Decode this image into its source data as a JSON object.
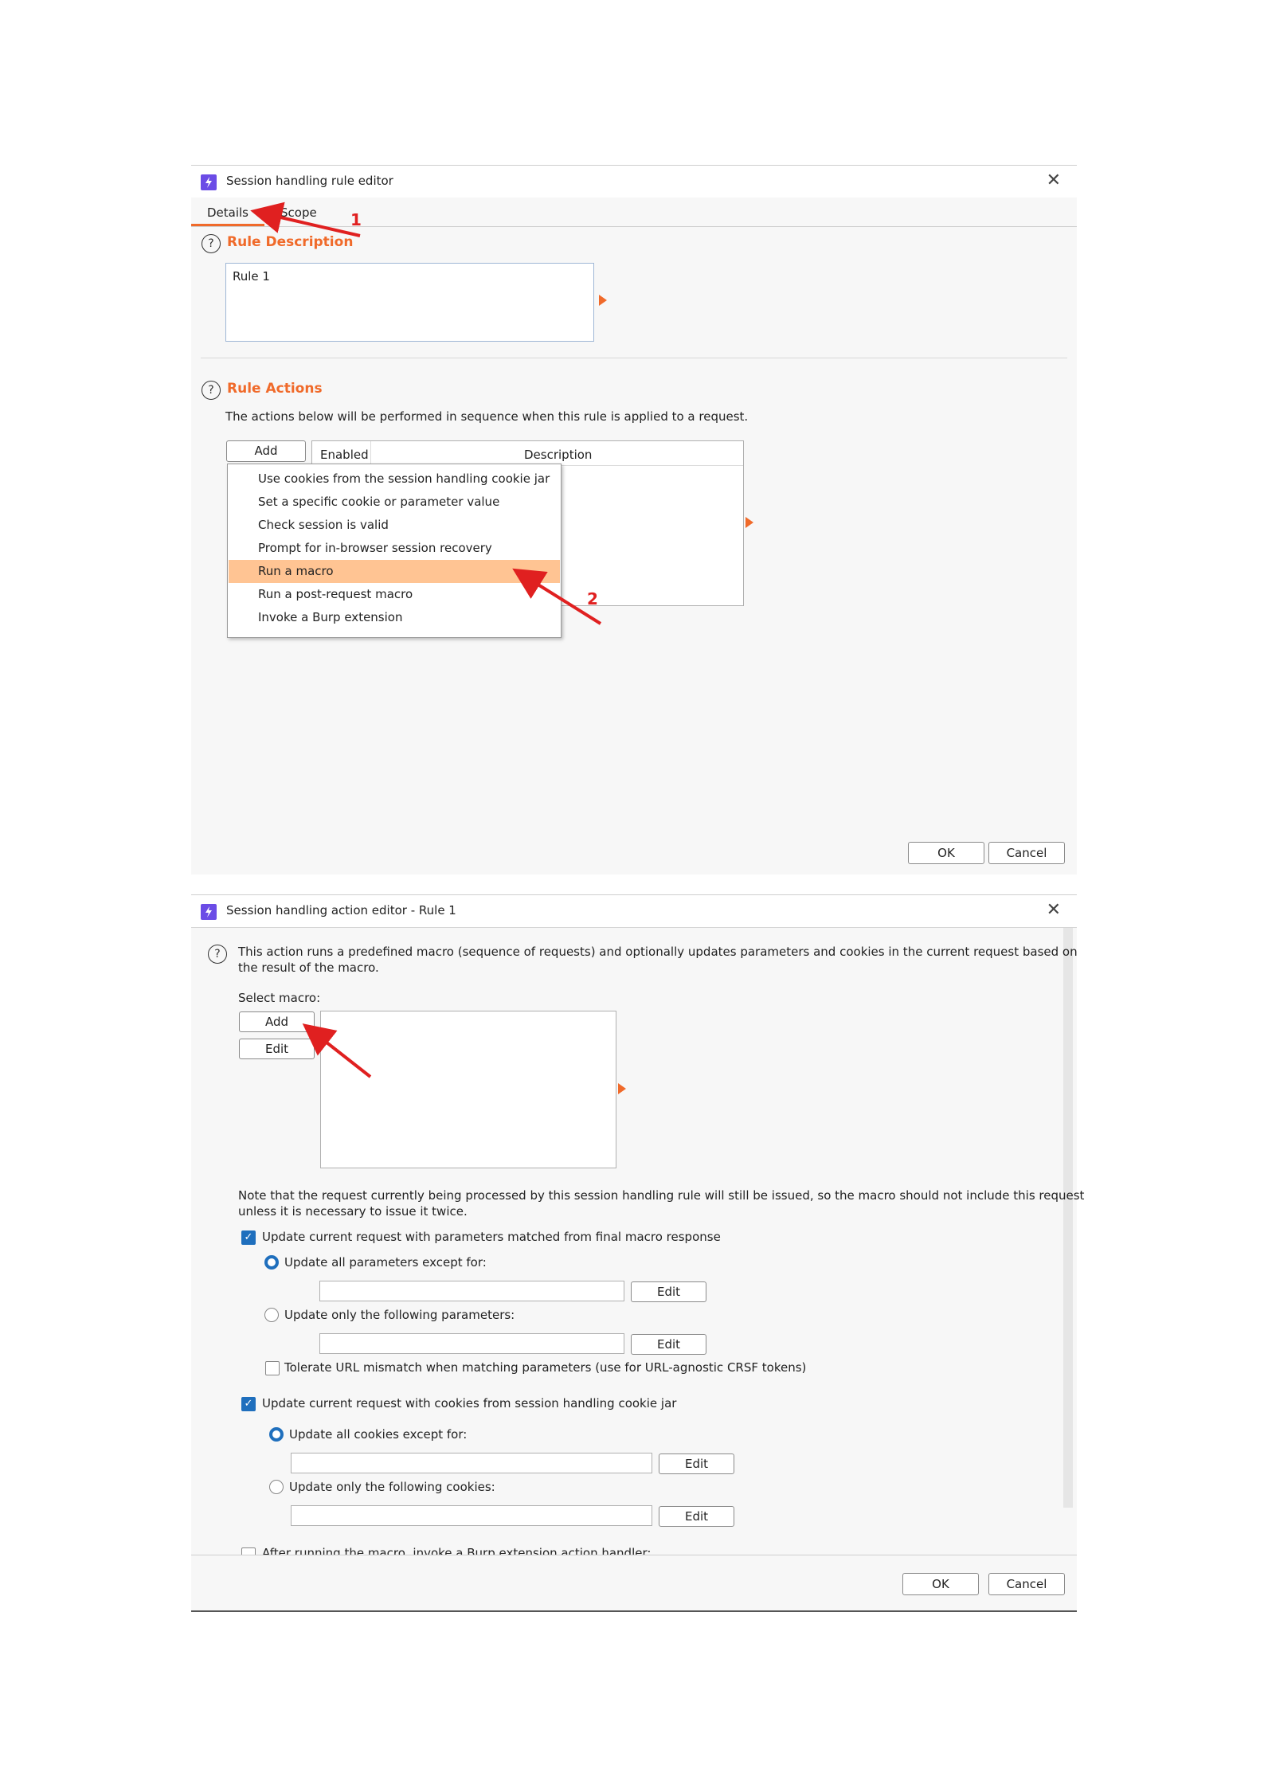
{
  "rule_editor": {
    "title": "Session handling rule editor",
    "tabs": [
      "Details",
      "Scope"
    ],
    "rule_description": {
      "heading": "Rule Description",
      "value": "Rule 1"
    },
    "rule_actions": {
      "heading": "Rule Actions",
      "intro": "The actions below will be performed in sequence when this rule is applied to a request.",
      "add_label": "Add",
      "columns": [
        "Enabled",
        "Description"
      ],
      "menu_items": [
        "Use cookies from the session handling cookie jar",
        "Set a specific cookie or parameter value",
        "Check session is valid",
        "Prompt for in-browser session recovery",
        "Run a macro",
        "Run a post-request macro",
        "Invoke a Burp extension"
      ],
      "highlighted_item": "Run a macro"
    },
    "ok_label": "OK",
    "cancel_label": "Cancel"
  },
  "action_editor": {
    "title": "Session handling action editor - Rule 1",
    "intro_line1": "This action runs a predefined macro (sequence of requests) and optionally updates parameters and cookies in the current request based on",
    "intro_line2": "the result of the macro.",
    "select_macro_label": "Select macro:",
    "add_label": "Add",
    "edit_label": "Edit",
    "note_line1": "Note that the request currently being processed by this session handling rule will still be issued, so the macro should not include this request",
    "note_line2": "unless it is necessary to issue it twice.",
    "update_params_label": "Update current request with parameters matched from final macro response",
    "update_params_checked": true,
    "params_all_except_label": "Update all parameters except for:",
    "params_only_label": "Update only the following parameters:",
    "params_selected": "all_except",
    "tolerate_url_label": "Tolerate URL mismatch when matching parameters (use for URL-agnostic CRSF tokens)",
    "tolerate_url_checked": false,
    "update_cookies_label": "Update current request with cookies from session handling cookie jar",
    "update_cookies_checked": true,
    "cookies_all_except_label": "Update all cookies except for:",
    "cookies_only_label": "Update only the following cookies:",
    "cookies_selected": "all_except",
    "after_running_label": "After running the macro, invoke a Burp extension action handler:",
    "after_running_checked": false,
    "ok_label": "OK",
    "cancel_label": "Cancel"
  },
  "annotations": {
    "step1": "1",
    "step2": "2"
  },
  "colors": {
    "accent": "#f06a2a",
    "highlight": "#ffc493",
    "checkbox": "#1f6fbd",
    "arrow": "#e02020",
    "app_icon": "#6b4ce6"
  }
}
